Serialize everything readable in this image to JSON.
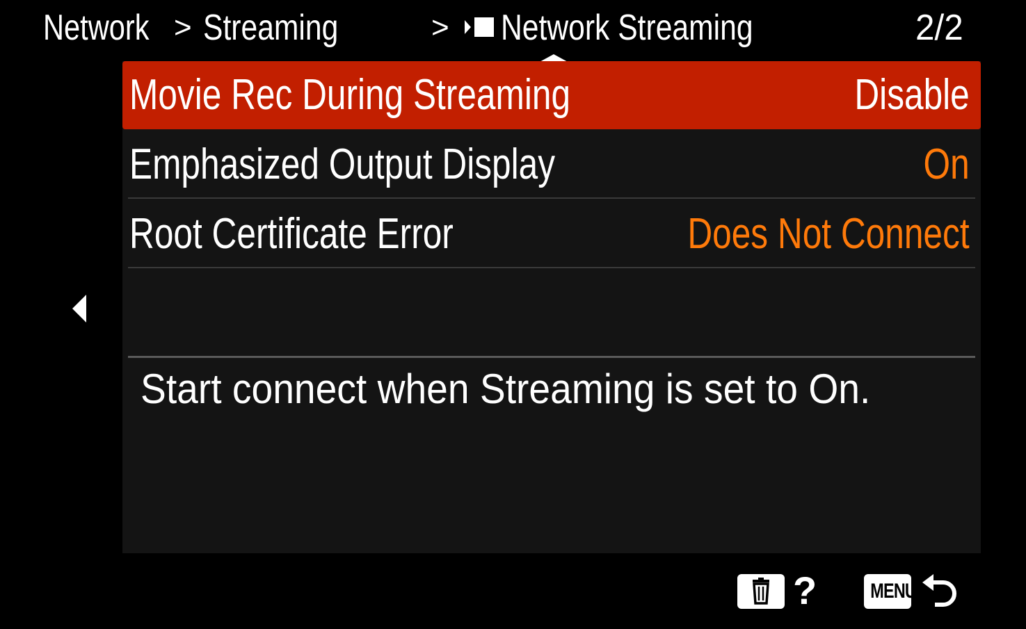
{
  "header": {
    "breadcrumb": [
      {
        "label": "Network"
      },
      {
        "label": ">"
      },
      {
        "label": "Streaming"
      },
      {
        "label": ">"
      },
      {
        "label": "Network Streaming",
        "icon": "movie-icon"
      }
    ],
    "page_indicator": "2/2"
  },
  "menu": {
    "items": [
      {
        "label": "Movie Rec During Streaming",
        "value": "Disable",
        "selected": true
      },
      {
        "label": "Emphasized Output Display",
        "value": "On",
        "selected": false
      },
      {
        "label": "Root Certificate Error",
        "value": "Does Not Connect",
        "selected": false
      }
    ]
  },
  "description": "Start connect when Streaming is set to On.",
  "footer": {
    "trash_icon": "trash-icon",
    "help_label": "?",
    "menu_label": "MENU",
    "back_icon": "back-arrow-icon"
  },
  "colors": {
    "selected_row": "#c21f00",
    "value_text": "#ff7a0a",
    "panel_bg": "#141414"
  }
}
